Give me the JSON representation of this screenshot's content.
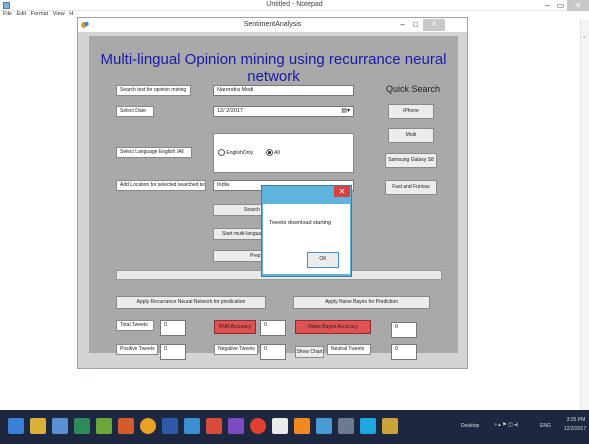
{
  "notepad": {
    "title": "Untitled - Notepad",
    "menu": [
      "File",
      "Edit",
      "Format",
      "View",
      "H"
    ],
    "min": "–",
    "max": "▭",
    "close": "✕"
  },
  "app": {
    "title": "SentimentAnalysis",
    "min": "–",
    "max": "□",
    "close": "✕",
    "heading": "Multi-lingual Opinion mining using recurrance neural network",
    "labels": {
      "search_text": "Search text for opinion mining",
      "select_date": "Select Date",
      "select_language": "Select Language English /All",
      "add_location": "Add Location for selected searched text"
    },
    "fields": {
      "search_text": "Narendra Modi",
      "date": "12/ 2/2017",
      "location": "India"
    },
    "radios": {
      "english_only": "EnglishOnly",
      "all": "All"
    },
    "buttons": {
      "search": "Search",
      "start_multilang": "Start multi-language",
      "prep": "Prep",
      "apply_rnn": "Apply Recurrance Neural Network for predication",
      "apply_nb": "Apply Naive Bayes for Prediction",
      "show_chart": "Show Chart"
    },
    "quick_search": {
      "title": "Quick Search",
      "items": [
        "iPhone",
        "Modi",
        "Samsung Galaxy S8",
        "Fast and Furious"
      ]
    },
    "stats": {
      "total_tweets_label": "Total Tweets",
      "total_tweets": "0",
      "rnn_accuracy_label": "RNN Accuracy",
      "rnn_accuracy": "0",
      "nb_accuracy_label": "Naive Bayes Accuracy",
      "nb_accuracy": "0",
      "positive_label": "Positive Tweets",
      "positive": "0",
      "negative_label": "Negative Tweets",
      "negative": "0",
      "neutral_label": "Neutral Tweets",
      "neutral": "0"
    }
  },
  "dialog": {
    "message": "Tweets download starting",
    "ok": "OK",
    "close": "✕"
  },
  "taskbar": {
    "desktop": "Desktop",
    "lang": "ENG",
    "time": "3:25 PM",
    "date": "12/2/2017"
  },
  "colors": {
    "heading": "#1a1aa8",
    "panel": "#a9a9a9",
    "accent_red": "#e05252",
    "dialog_border": "#5fb4dd",
    "taskbar": "#1d2840"
  }
}
